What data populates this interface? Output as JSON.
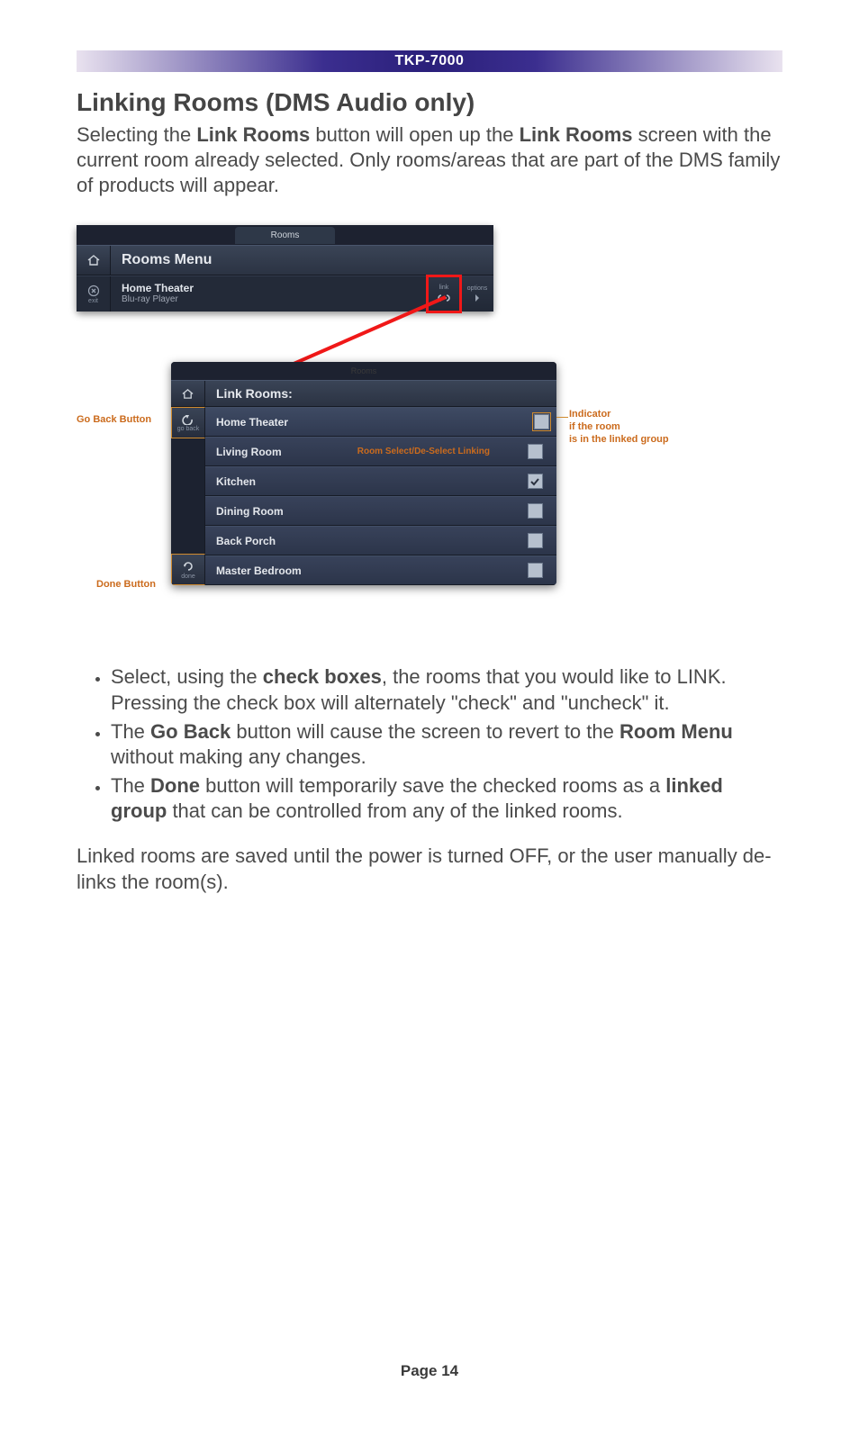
{
  "banner": "TKP-7000",
  "section_title": "Linking Rooms (DMS Audio only)",
  "intro": {
    "p1a": "Selecting the ",
    "p1b": "Link Rooms",
    "p1c": " button will open up the ",
    "p1d": "Link Rooms",
    "p1e": " screen with the current room already selected. Only rooms/areas that are part of the DMS family of products will appear."
  },
  "panel_top": {
    "tab": "Rooms",
    "menu_title": "Rooms Menu",
    "exit_label": "exit",
    "current_room": "Home Theater",
    "current_source": "Blu-ray Player",
    "link_label": "link",
    "options_label": "options"
  },
  "panel_bottom": {
    "tab": "Rooms",
    "header": "Link Rooms:",
    "go_back_label": "go back",
    "done_label": "done",
    "rooms": [
      {
        "name": "Home Theater",
        "checked": false,
        "indicator": true
      },
      {
        "name": "Living Room",
        "checked": false,
        "extra": "Room Select/De-Select Linking"
      },
      {
        "name": "Kitchen",
        "checked": true
      },
      {
        "name": "Dining Room",
        "checked": false
      },
      {
        "name": "Back Porch",
        "checked": false
      },
      {
        "name": "Master Bedroom",
        "checked": false
      }
    ]
  },
  "callouts": {
    "go_back": "Go Back Button",
    "done": "Done Button",
    "indicator_l1": "Indicator",
    "indicator_l2": "if the room",
    "indicator_l3": "is in the linked group"
  },
  "bullets": {
    "b1a": "Select, using the ",
    "b1b": "check boxes",
    "b1c": ", the rooms that you would like to LINK. Pressing the check box will alternately \"check\" and \"uncheck\" it.",
    "b2a": "The ",
    "b2b": "Go Back",
    "b2c": " button will cause the screen to revert to the ",
    "b2d": "Room Menu",
    "b2e": " without making any changes.",
    "b3a": "The ",
    "b3b": "Done",
    "b3c": " button will temporarily save the checked rooms as a ",
    "b3d": "linked group",
    "b3e": " that can be controlled from any of the linked rooms."
  },
  "after_text": "Linked rooms are saved until the power is turned OFF, or the user manually de-links the room(s).",
  "footer": "Page 14"
}
